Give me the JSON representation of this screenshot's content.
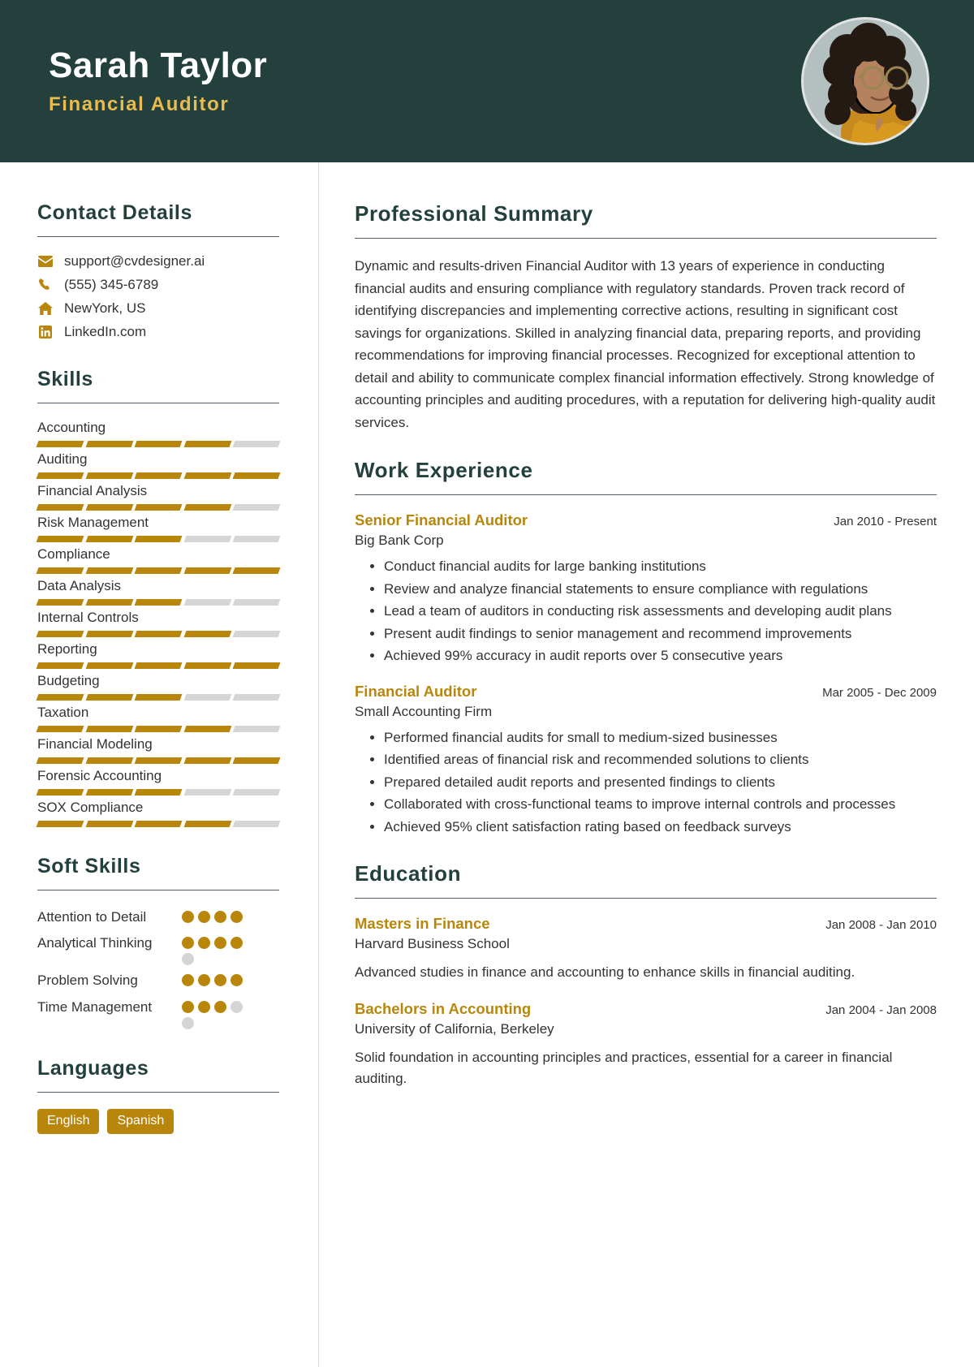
{
  "header": {
    "name": "Sarah Taylor",
    "role": "Financial Auditor",
    "avatar_alt": "profile-photo"
  },
  "sidebar": {
    "contact": {
      "title": "Contact Details",
      "items": [
        {
          "icon": "envelope-icon",
          "value": "support@cvdesigner.ai"
        },
        {
          "icon": "phone-icon",
          "value": "(555) 345-6789"
        },
        {
          "icon": "home-icon",
          "value": "NewYork, US"
        },
        {
          "icon": "linkedin-icon",
          "value": "LinkedIn.com"
        }
      ]
    },
    "skills": {
      "title": "Skills",
      "max": 5,
      "items": [
        {
          "label": "Accounting",
          "level": 4
        },
        {
          "label": "Auditing",
          "level": 5
        },
        {
          "label": "Financial Analysis",
          "level": 4
        },
        {
          "label": "Risk Management",
          "level": 3
        },
        {
          "label": "Compliance",
          "level": 5
        },
        {
          "label": "Data Analysis",
          "level": 3
        },
        {
          "label": "Internal Controls",
          "level": 4
        },
        {
          "label": "Reporting",
          "level": 5
        },
        {
          "label": "Budgeting",
          "level": 3
        },
        {
          "label": "Taxation",
          "level": 4
        },
        {
          "label": "Financial Modeling",
          "level": 5
        },
        {
          "label": "Forensic Accounting",
          "level": 3
        },
        {
          "label": "SOX Compliance",
          "level": 4
        }
      ]
    },
    "soft_skills": {
      "title": "Soft Skills",
      "max": 5,
      "items": [
        {
          "label": "Attention to Detail",
          "level": 4,
          "total": 4
        },
        {
          "label": "Analytical Thinking",
          "level": 4,
          "total": 5
        },
        {
          "label": "Problem Solving",
          "level": 4,
          "total": 4
        },
        {
          "label": "Time Management",
          "level": 3,
          "total": 5
        }
      ]
    },
    "languages": {
      "title": "Languages",
      "items": [
        "English",
        "Spanish"
      ]
    }
  },
  "main": {
    "summary": {
      "title": "Professional Summary",
      "text": "Dynamic and results-driven Financial Auditor with 13 years of experience in conducting financial audits and ensuring compliance with regulatory standards. Proven track record of identifying discrepancies and implementing corrective actions, resulting in significant cost savings for organizations. Skilled in analyzing financial data, preparing reports, and providing recommendations for improving financial processes. Recognized for exceptional attention to detail and ability to communicate complex financial information effectively. Strong knowledge of accounting principles and auditing procedures, with a reputation for delivering high-quality audit services."
    },
    "work": {
      "title": "Work Experience",
      "entries": [
        {
          "title": "Senior Financial Auditor",
          "date": "Jan 2010 - Present",
          "org": "Big Bank Corp",
          "bullets": [
            "Conduct financial audits for large banking institutions",
            "Review and analyze financial statements to ensure compliance with regulations",
            "Lead a team of auditors in conducting risk assessments and developing audit plans",
            "Present audit findings to senior management and recommend improvements",
            "Achieved 99% accuracy in audit reports over 5 consecutive years"
          ]
        },
        {
          "title": "Financial Auditor",
          "date": "Mar 2005 - Dec 2009",
          "org": "Small Accounting Firm",
          "bullets": [
            "Performed financial audits for small to medium-sized businesses",
            "Identified areas of financial risk and recommended solutions to clients",
            "Prepared detailed audit reports and presented findings to clients",
            "Collaborated with cross-functional teams to improve internal controls and processes",
            "Achieved 95% client satisfaction rating based on feedback surveys"
          ]
        }
      ]
    },
    "education": {
      "title": "Education",
      "entries": [
        {
          "title": "Masters in Finance",
          "date": "Jan 2008 - Jan 2010",
          "org": "Harvard Business School",
          "desc": "Advanced studies in finance and accounting to enhance skills in financial auditing."
        },
        {
          "title": "Bachelors in Accounting",
          "date": "Jan 2004 - Jan 2008",
          "org": "University of California, Berkeley",
          "desc": "Solid foundation in accounting principles and practices, essential for a career in financial auditing."
        }
      ]
    }
  },
  "colors": {
    "header_bg": "#23403d",
    "accent_gold": "#b8860b",
    "role_gold": "#e8bc4e",
    "rule": "#525e6b",
    "empty_bar": "#d5d5d5"
  }
}
